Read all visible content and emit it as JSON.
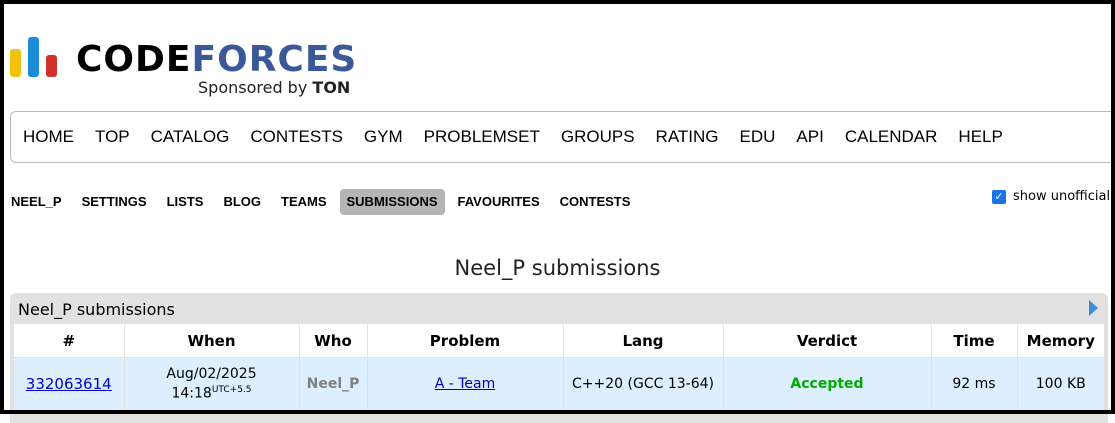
{
  "logo": {
    "word_code": "CODE",
    "word_forces": "FORCES",
    "sponsor_prefix": "Sponsored by",
    "sponsor_name": "TON"
  },
  "main_menu": [
    "HOME",
    "TOP",
    "CATALOG",
    "CONTESTS",
    "GYM",
    "PROBLEMSET",
    "GROUPS",
    "RATING",
    "EDU",
    "API",
    "CALENDAR",
    "HELP"
  ],
  "second_menu": {
    "items": [
      "NEEL_P",
      "SETTINGS",
      "LISTS",
      "BLOG",
      "TEAMS",
      "SUBMISSIONS",
      "FAVOURITES",
      "CONTESTS"
    ],
    "active": "SUBMISSIONS"
  },
  "unofficial": {
    "label": "show unofficial",
    "checked": true
  },
  "page_title": "Neel_P submissions",
  "table": {
    "caption": "Neel_P submissions",
    "headers": [
      "#",
      "When",
      "Who",
      "Problem",
      "Lang",
      "Verdict",
      "Time",
      "Memory"
    ],
    "rows": [
      {
        "id": "332063614",
        "when_date": "Aug/02/2025",
        "when_time": "14:18",
        "when_tz": "UTC+5.5",
        "who": "Neel_P",
        "problem": "A - Team",
        "lang": "C++20 (GCC 13-64)",
        "verdict": "Accepted",
        "time": "92 ms",
        "memory": "100 KB"
      }
    ]
  },
  "colors": {
    "brand_blue": "#3b5998",
    "logo_yellow": "#f4c20d",
    "logo_blue": "#1a8cd8",
    "logo_red": "#d0312d",
    "accepted": "#00aa00",
    "link": "#0000cc",
    "row_bg": "#ddeeff"
  }
}
